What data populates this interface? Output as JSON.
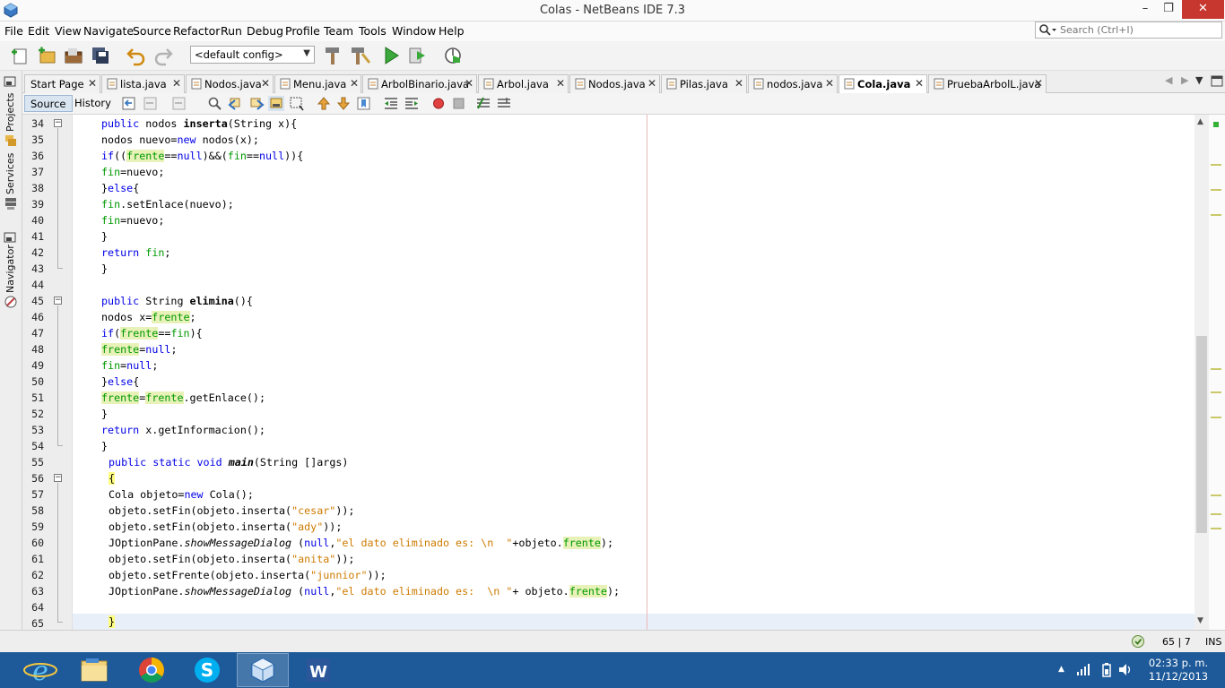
{
  "window": {
    "title": "Colas - NetBeans IDE 7.3",
    "min_glyph": "–",
    "max_glyph": "❐",
    "close_glyph": "✕"
  },
  "menu": [
    "File",
    "Edit",
    "View",
    "Navigate",
    "Source",
    "Refactor",
    "Run",
    "Debug",
    "Profile",
    "Team",
    "Tools",
    "Window",
    "Help"
  ],
  "search": {
    "placeholder": "Search (Ctrl+I)"
  },
  "toolbar": {
    "config_value": "<default config>",
    "icons": [
      "new-file-icon",
      "new-project-icon",
      "open-project-icon",
      "save-all-icon",
      "undo-icon",
      "redo-icon",
      "build-icon",
      "clean-build-icon",
      "run-icon",
      "debug-icon",
      "profile-icon"
    ]
  },
  "sidebar": {
    "tabs": [
      "Projects",
      "Services",
      "Navigator"
    ]
  },
  "tabs": [
    {
      "label": "Start Page",
      "active": false
    },
    {
      "label": "lista.java",
      "active": false
    },
    {
      "label": "Nodos.java",
      "active": false
    },
    {
      "label": "Menu.java",
      "active": false
    },
    {
      "label": "ArbolBinario.java",
      "active": false
    },
    {
      "label": "Arbol.java",
      "active": false
    },
    {
      "label": "Nodos.java",
      "active": false
    },
    {
      "label": "Pilas.java",
      "active": false
    },
    {
      "label": "nodos.java",
      "active": false
    },
    {
      "label": "Cola.java",
      "active": true
    },
    {
      "label": "PruebaArbolL.java",
      "active": false
    }
  ],
  "editor_toolbar": {
    "source_label": "Source",
    "history_label": "History"
  },
  "code": {
    "line_numbers": [
      "34",
      "35",
      "36",
      "37",
      "38",
      "39",
      "40",
      "41",
      "42",
      "43",
      "44",
      "45",
      "46",
      "47",
      "48",
      "49",
      "50",
      "51",
      "52",
      "53",
      "54",
      "55",
      "56",
      "57",
      "58",
      "59",
      "60",
      "61",
      "62",
      "63",
      "64",
      "65"
    ]
  },
  "status": {
    "position": "65 | 7",
    "mode": "INS"
  },
  "taskbar": {
    "apps": [
      "internet-explorer",
      "file-explorer",
      "chrome",
      "skype",
      "netbeans",
      "word"
    ],
    "time": "02:33 p. m.",
    "date": "11/12/2013"
  }
}
